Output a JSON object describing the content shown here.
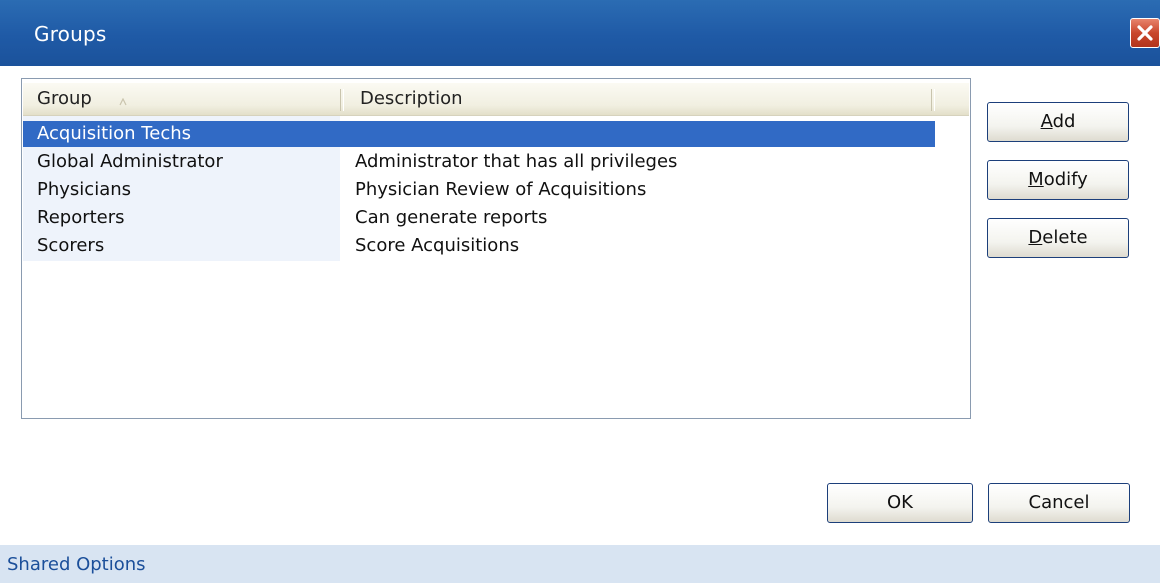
{
  "window": {
    "title": "Groups",
    "close_icon": "close-icon"
  },
  "list": {
    "columns": [
      {
        "label": "Group",
        "sorted": "ascending"
      },
      {
        "label": "Description"
      }
    ],
    "rows": [
      {
        "group": "Acquisition Techs",
        "description": "",
        "selected": true
      },
      {
        "group": "Global Administrator",
        "description": "Administrator that has all privileges",
        "selected": false
      },
      {
        "group": "Physicians",
        "description": "Physician Review of Acquisitions",
        "selected": false
      },
      {
        "group": "Reporters",
        "description": "Can generate reports",
        "selected": false
      },
      {
        "group": "Scorers",
        "description": "Score Acquisitions",
        "selected": false
      }
    ]
  },
  "side_buttons": {
    "add": {
      "mnemonic": "A",
      "rest": "dd"
    },
    "modify": {
      "mnemonic": "M",
      "rest": "odify"
    },
    "delete": {
      "mnemonic": "D",
      "rest": "elete"
    }
  },
  "footer_buttons": {
    "ok": "OK",
    "cancel": "Cancel"
  },
  "footer": {
    "label": "Shared Options"
  },
  "colors": {
    "titlebar": "#1f5aa6",
    "selection": "#316ac5",
    "close_button": "#c9472c",
    "footer_bg": "#d8e4f2",
    "footer_text": "#1b4f9a"
  }
}
